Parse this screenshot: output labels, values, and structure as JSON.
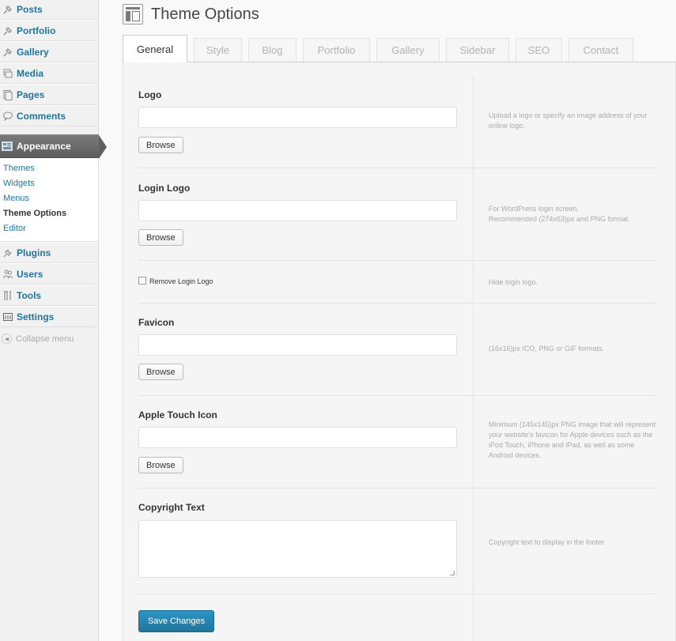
{
  "sidebar": {
    "top_items": [
      {
        "label": "Posts",
        "icon": "pin-icon"
      },
      {
        "label": "Portfolio",
        "icon": "pin-icon"
      },
      {
        "label": "Gallery",
        "icon": "pin-icon"
      },
      {
        "label": "Media",
        "icon": "media-icon"
      },
      {
        "label": "Pages",
        "icon": "pages-icon"
      },
      {
        "label": "Comments",
        "icon": "comment-icon"
      }
    ],
    "active_item": {
      "label": "Appearance",
      "icon": "appearance-icon"
    },
    "submenu": [
      "Themes",
      "Widgets",
      "Menus",
      "Theme Options",
      "Editor"
    ],
    "bottom_items": [
      {
        "label": "Plugins",
        "icon": "plug-icon"
      },
      {
        "label": "Users",
        "icon": "users-icon"
      },
      {
        "label": "Tools",
        "icon": "tools-icon"
      },
      {
        "label": "Settings",
        "icon": "settings-icon"
      }
    ],
    "collapse_label": "Collapse menu"
  },
  "page": {
    "title": "Theme Options"
  },
  "tabs": [
    "General",
    "Style",
    "Blog",
    "Portfolio",
    "Gallery",
    "Sidebar",
    "SEO",
    "Contact"
  ],
  "active_tab": "General",
  "fields": {
    "logo": {
      "label": "Logo",
      "value": "",
      "button": "Browse",
      "description": "Upload a logo or specify an image address of your online logo."
    },
    "login_logo": {
      "label": "Login Logo",
      "value": "",
      "button": "Browse",
      "description": "For WordPress login screen.\nRecommended (274x63)px and PNG format."
    },
    "remove_login_logo": {
      "label": "Remove Login Logo",
      "checked": false,
      "description": "Hide login logo."
    },
    "favicon": {
      "label": "Favicon",
      "value": "",
      "button": "Browse",
      "description": "(16x16)px ICO, PNG or GIF formats."
    },
    "apple_touch_icon": {
      "label": "Apple Touch Icon",
      "value": "",
      "button": "Browse",
      "description": "Minimum (145x145)px PNG image that will represent your website's favicon for Apple devices such as the iPod Touch, iPhone and iPad, as well as some Android devices."
    },
    "copyright_text": {
      "label": "Copyright Text",
      "value": "",
      "description": "Copyright text to display in the footer."
    }
  },
  "save_button": "Save Changes",
  "colors": {
    "link": "#21759b",
    "primary_button": "#21759b",
    "active_menu_bg": "#5d5d5d"
  }
}
